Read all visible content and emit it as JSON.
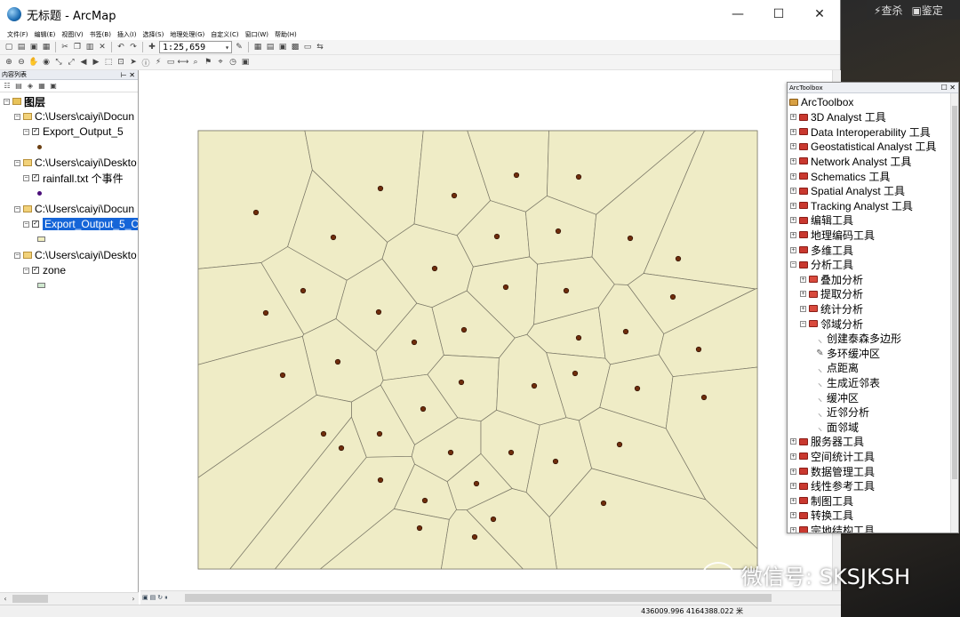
{
  "window": {
    "title": "无标题 - ArcMap",
    "minimize": "—",
    "maximize": "☐",
    "close": "✕"
  },
  "desktop": {
    "btn1": "查杀",
    "btn2": "鉴定"
  },
  "menu": [
    "文件(F)",
    "编辑(E)",
    "视图(V)",
    "书签(B)",
    "插入(I)",
    "选择(S)",
    "地理处理(G)",
    "自定义(C)",
    "窗口(W)",
    "帮助(H)"
  ],
  "toolbar": {
    "scale": "1:25,659"
  },
  "toc": {
    "title": "内容列表",
    "root": "图层",
    "layers": [
      {
        "path": "C:\\Users\\caiyi\\Docun",
        "name": "Export_Output_5",
        "symbol": "point",
        "color": "#6b3f12"
      },
      {
        "path": "C:\\Users\\caiyi\\Deskto",
        "name": "rainfall.txt 个事件",
        "symbol": "point",
        "color": "#4b0f7a"
      },
      {
        "path": "C:\\Users\\caiyi\\Docun",
        "name": "Export_Output_5_C",
        "symbol": "poly",
        "color": "#f2efc0",
        "selected": true
      },
      {
        "path": "C:\\Users\\caiyi\\Deskto",
        "name": "zone",
        "symbol": "poly",
        "color": "#cfe8cf"
      }
    ]
  },
  "map": {
    "fill": "#efecc6",
    "edge": "#7a7766",
    "point_color": "#6e2c0b"
  },
  "toolbox": {
    "title": "ArcToolbox",
    "root": "ArcToolbox",
    "items": [
      {
        "label": "3D Analyst 工具",
        "level": 1,
        "type": "box",
        "exp": "+"
      },
      {
        "label": "Data Interoperability 工具",
        "level": 1,
        "type": "box",
        "exp": "+"
      },
      {
        "label": "Geostatistical Analyst 工具",
        "level": 1,
        "type": "box",
        "exp": "+"
      },
      {
        "label": "Network Analyst 工具",
        "level": 1,
        "type": "box",
        "exp": "+"
      },
      {
        "label": "Schematics 工具",
        "level": 1,
        "type": "box",
        "exp": "+"
      },
      {
        "label": "Spatial Analyst 工具",
        "level": 1,
        "type": "box",
        "exp": "+"
      },
      {
        "label": "Tracking Analyst 工具",
        "level": 1,
        "type": "box",
        "exp": "+"
      },
      {
        "label": "编辑工具",
        "level": 1,
        "type": "box",
        "exp": "+"
      },
      {
        "label": "地理编码工具",
        "level": 1,
        "type": "box",
        "exp": "+"
      },
      {
        "label": "多维工具",
        "level": 1,
        "type": "box",
        "exp": "+"
      },
      {
        "label": "分析工具",
        "level": 1,
        "type": "box",
        "exp": "−"
      },
      {
        "label": "叠加分析",
        "level": 2,
        "type": "sub",
        "exp": "+"
      },
      {
        "label": "提取分析",
        "level": 2,
        "type": "sub",
        "exp": "+"
      },
      {
        "label": "统计分析",
        "level": 2,
        "type": "sub",
        "exp": "+"
      },
      {
        "label": "邻域分析",
        "level": 2,
        "type": "sub",
        "exp": "−"
      },
      {
        "label": "创建泰森多边形",
        "level": 3,
        "type": "tool",
        "exp": ""
      },
      {
        "label": "多环缓冲区",
        "level": 3,
        "type": "script",
        "exp": ""
      },
      {
        "label": "点距离",
        "level": 3,
        "type": "tool",
        "exp": ""
      },
      {
        "label": "生成近邻表",
        "level": 3,
        "type": "tool",
        "exp": ""
      },
      {
        "label": "缓冲区",
        "level": 3,
        "type": "tool",
        "exp": ""
      },
      {
        "label": "近邻分析",
        "level": 3,
        "type": "tool",
        "exp": ""
      },
      {
        "label": "面邻域",
        "level": 3,
        "type": "tool",
        "exp": ""
      },
      {
        "label": "服务器工具",
        "level": 1,
        "type": "box",
        "exp": "+"
      },
      {
        "label": "空间统计工具",
        "level": 1,
        "type": "box",
        "exp": "+"
      },
      {
        "label": "数据管理工具",
        "level": 1,
        "type": "box",
        "exp": "+"
      },
      {
        "label": "线性参考工具",
        "level": 1,
        "type": "box",
        "exp": "+"
      },
      {
        "label": "制图工具",
        "level": 1,
        "type": "box",
        "exp": "+"
      },
      {
        "label": "转换工具",
        "level": 1,
        "type": "box",
        "exp": "+"
      },
      {
        "label": "宗地结构工具",
        "level": 1,
        "type": "box",
        "exp": "+"
      }
    ]
  },
  "status": {
    "coords": "436009.996  4164388.022 米"
  },
  "watermark": "微信号: SKSJKSH"
}
